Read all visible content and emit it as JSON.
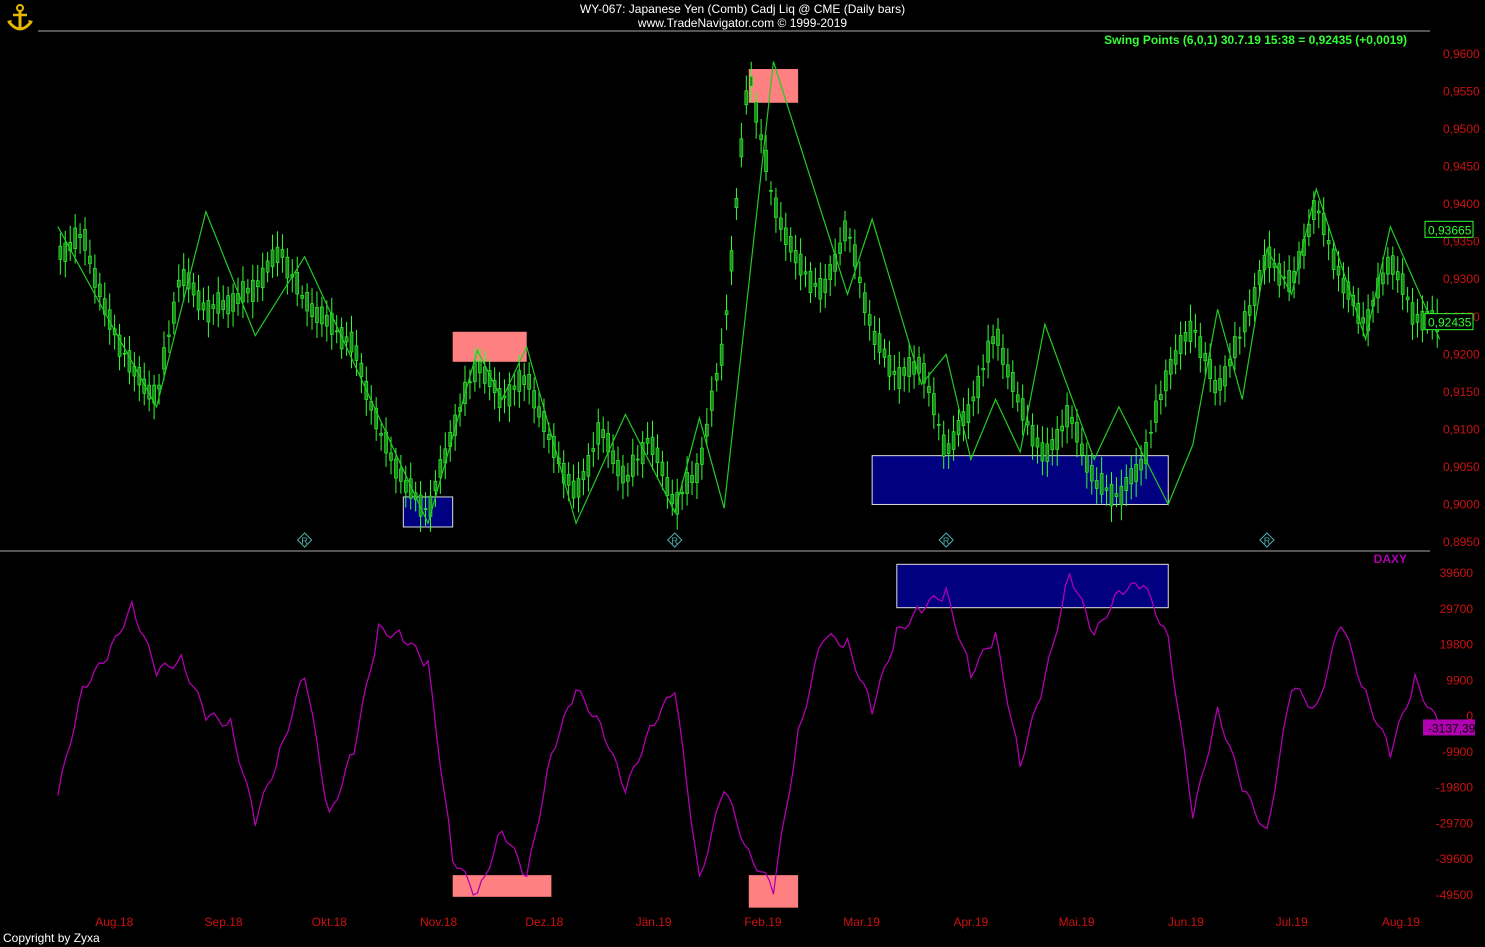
{
  "header": {
    "title": "WY-067:  Japanese Yen (Comb) Cadj Liq @ CME  (Daily bars)",
    "source": "www.TradeNavigator.com © 1999-2019"
  },
  "footer": {
    "copyright": "Copyright by Zyxa"
  },
  "colors": {
    "price": "#33ff33",
    "zigzag": "#22cc22",
    "axis_text": "#cc1111",
    "indicator": "#b000b0",
    "highlight_red": "#ff8080",
    "highlight_blue": "#000080",
    "separator": "#444444"
  },
  "chart_data": [
    {
      "type": "candlestick",
      "name": "Japanese Yen (Comb) Cadj Liq @ CME",
      "legend": "Swing Points (6,0,1)   30.7.19 15:38 = 0,92435 (+0,0019)",
      "ylim": [
        0.895,
        0.96
      ],
      "y_ticks": [
        "0,9600",
        "0,9550",
        "0,9500",
        "0,9450",
        "0,9400",
        "0,9350",
        "0,9300",
        "0,9250",
        "0,9200",
        "0,9150",
        "0,9100",
        "0,9050",
        "0,9000",
        "0,8950"
      ],
      "y_tick_values": [
        0.96,
        0.955,
        0.95,
        0.945,
        0.94,
        0.935,
        0.93,
        0.925,
        0.92,
        0.915,
        0.91,
        0.905,
        0.9,
        0.895
      ],
      "price_labels": [
        {
          "text": "0,93665",
          "value": 0.93665
        },
        {
          "text": "0,92435",
          "value": 0.92435
        }
      ],
      "close_series": [
        {
          "date": "2018-07-16",
          "value": 0.933
        },
        {
          "date": "2018-07-23",
          "value": 0.936
        },
        {
          "date": "2018-07-30",
          "value": 0.925
        },
        {
          "date": "2018-08-06",
          "value": 0.918
        },
        {
          "date": "2018-08-13",
          "value": 0.914
        },
        {
          "date": "2018-08-20",
          "value": 0.931
        },
        {
          "date": "2018-08-27",
          "value": 0.926
        },
        {
          "date": "2018-09-03",
          "value": 0.927
        },
        {
          "date": "2018-09-10",
          "value": 0.929
        },
        {
          "date": "2018-09-17",
          "value": 0.934
        },
        {
          "date": "2018-09-24",
          "value": 0.927
        },
        {
          "date": "2018-10-01",
          "value": 0.924
        },
        {
          "date": "2018-10-08",
          "value": 0.921
        },
        {
          "date": "2018-10-15",
          "value": 0.91
        },
        {
          "date": "2018-10-22",
          "value": 0.903
        },
        {
          "date": "2018-10-29",
          "value": 0.899
        },
        {
          "date": "2018-11-05",
          "value": 0.91
        },
        {
          "date": "2018-11-12",
          "value": 0.919
        },
        {
          "date": "2018-11-19",
          "value": 0.914
        },
        {
          "date": "2018-11-26",
          "value": 0.917
        },
        {
          "date": "2018-12-03",
          "value": 0.908
        },
        {
          "date": "2018-12-10",
          "value": 0.901
        },
        {
          "date": "2018-12-17",
          "value": 0.91
        },
        {
          "date": "2018-12-24",
          "value": 0.903
        },
        {
          "date": "2018-12-31",
          "value": 0.909
        },
        {
          "date": "2019-01-07",
          "value": 0.9
        },
        {
          "date": "2019-01-14",
          "value": 0.905
        },
        {
          "date": "2019-01-21",
          "value": 0.922
        },
        {
          "date": "2019-01-28",
          "value": 0.958
        },
        {
          "date": "2019-02-04",
          "value": 0.94
        },
        {
          "date": "2019-02-11",
          "value": 0.932
        },
        {
          "date": "2019-02-18",
          "value": 0.928
        },
        {
          "date": "2019-02-25",
          "value": 0.937
        },
        {
          "date": "2019-03-04",
          "value": 0.923
        },
        {
          "date": "2019-03-11",
          "value": 0.917
        },
        {
          "date": "2019-03-18",
          "value": 0.919
        },
        {
          "date": "2019-03-25",
          "value": 0.907
        },
        {
          "date": "2019-04-01",
          "value": 0.913
        },
        {
          "date": "2019-04-08",
          "value": 0.923
        },
        {
          "date": "2019-04-15",
          "value": 0.913
        },
        {
          "date": "2019-04-22",
          "value": 0.906
        },
        {
          "date": "2019-04-29",
          "value": 0.912
        },
        {
          "date": "2019-05-06",
          "value": 0.903
        },
        {
          "date": "2019-05-13",
          "value": 0.901
        },
        {
          "date": "2019-05-20",
          "value": 0.906
        },
        {
          "date": "2019-05-27",
          "value": 0.918
        },
        {
          "date": "2019-06-03",
          "value": 0.924
        },
        {
          "date": "2019-06-10",
          "value": 0.915
        },
        {
          "date": "2019-06-17",
          "value": 0.923
        },
        {
          "date": "2019-06-24",
          "value": 0.933
        },
        {
          "date": "2019-07-01",
          "value": 0.929
        },
        {
          "date": "2019-07-08",
          "value": 0.94
        },
        {
          "date": "2019-07-15",
          "value": 0.93
        },
        {
          "date": "2019-07-22",
          "value": 0.924
        },
        {
          "date": "2019-07-29",
          "value": 0.933
        },
        {
          "date": "2019-08-05",
          "value": 0.925
        },
        {
          "date": "2019-08-12",
          "value": 0.92435
        }
      ],
      "swing_points": [
        {
          "date": "2018-07-16",
          "value": 0.937
        },
        {
          "date": "2018-08-13",
          "value": 0.913
        },
        {
          "date": "2018-08-27",
          "value": 0.939
        },
        {
          "date": "2018-09-10",
          "value": 0.9225
        },
        {
          "date": "2018-09-24",
          "value": 0.933
        },
        {
          "date": "2018-10-29",
          "value": 0.8975
        },
        {
          "date": "2018-11-12",
          "value": 0.9205
        },
        {
          "date": "2018-11-19",
          "value": 0.914
        },
        {
          "date": "2018-11-26",
          "value": 0.921
        },
        {
          "date": "2018-12-10",
          "value": 0.8975
        },
        {
          "date": "2018-12-24",
          "value": 0.912
        },
        {
          "date": "2019-01-07",
          "value": 0.899
        },
        {
          "date": "2019-01-14",
          "value": 0.9115
        },
        {
          "date": "2019-01-21",
          "value": 0.8995
        },
        {
          "date": "2019-02-04",
          "value": 0.959
        },
        {
          "date": "2019-02-25",
          "value": 0.928
        },
        {
          "date": "2019-03-04",
          "value": 0.938
        },
        {
          "date": "2019-03-18",
          "value": 0.916
        },
        {
          "date": "2019-03-25",
          "value": 0.92
        },
        {
          "date": "2019-04-01",
          "value": 0.906
        },
        {
          "date": "2019-04-08",
          "value": 0.914
        },
        {
          "date": "2019-04-15",
          "value": 0.907
        },
        {
          "date": "2019-04-22",
          "value": 0.924
        },
        {
          "date": "2019-05-06",
          "value": 0.906
        },
        {
          "date": "2019-05-13",
          "value": 0.913
        },
        {
          "date": "2019-05-27",
          "value": 0.9
        },
        {
          "date": "2019-06-03",
          "value": 0.908
        },
        {
          "date": "2019-06-10",
          "value": 0.926
        },
        {
          "date": "2019-06-17",
          "value": 0.914
        },
        {
          "date": "2019-06-24",
          "value": 0.934
        },
        {
          "date": "2019-07-01",
          "value": 0.928
        },
        {
          "date": "2019-07-08",
          "value": 0.942
        },
        {
          "date": "2019-07-22",
          "value": 0.922
        },
        {
          "date": "2019-07-29",
          "value": 0.937
        },
        {
          "date": "2019-08-12",
          "value": 0.922
        }
      ],
      "highlight_zones": [
        {
          "color": "blue",
          "from": "2018-10-22",
          "to": "2018-11-05",
          "y": [
            0.897,
            0.901
          ]
        },
        {
          "color": "red",
          "from": "2018-11-05",
          "to": "2018-11-26",
          "y": [
            0.919,
            0.923
          ]
        },
        {
          "color": "red",
          "from": "2019-01-28",
          "to": "2019-02-11",
          "y": [
            0.9535,
            0.958
          ]
        },
        {
          "color": "blue",
          "from": "2019-03-04",
          "to": "2019-05-27",
          "y": [
            0.9,
            0.9065
          ]
        }
      ],
      "markers": [
        {
          "date": "2018-09-24",
          "label": "R"
        },
        {
          "date": "2019-01-07",
          "label": "R"
        },
        {
          "date": "2019-03-25",
          "label": "R"
        },
        {
          "date": "2019-06-24",
          "label": "R"
        }
      ]
    },
    {
      "type": "line",
      "series_name": "DAXY",
      "ylim": [
        -55000,
        44000
      ],
      "y_ticks": [
        "39600",
        "29700",
        "19800",
        "9900",
        "0",
        "-9900",
        "-19800",
        "-29700",
        "-39600",
        "-49500"
      ],
      "y_tick_values": [
        39600,
        29700,
        19800,
        9900,
        0,
        -9900,
        -19800,
        -29700,
        -39600,
        -49500
      ],
      "current_label": "-3137,39",
      "current_value": -3137.39,
      "values": [
        {
          "date": "2018-07-16",
          "value": -22000
        },
        {
          "date": "2018-07-23",
          "value": 8000
        },
        {
          "date": "2018-07-30",
          "value": 16000
        },
        {
          "date": "2018-08-06",
          "value": 31000
        },
        {
          "date": "2018-08-13",
          "value": 12000
        },
        {
          "date": "2018-08-20",
          "value": 16000
        },
        {
          "date": "2018-08-27",
          "value": 0
        },
        {
          "date": "2018-09-03",
          "value": -2000
        },
        {
          "date": "2018-09-10",
          "value": -29000
        },
        {
          "date": "2018-09-17",
          "value": -10000
        },
        {
          "date": "2018-09-24",
          "value": 12000
        },
        {
          "date": "2018-10-01",
          "value": -28000
        },
        {
          "date": "2018-10-08",
          "value": -9000
        },
        {
          "date": "2018-10-15",
          "value": 24000
        },
        {
          "date": "2018-10-22",
          "value": 22000
        },
        {
          "date": "2018-10-29",
          "value": 14000
        },
        {
          "date": "2018-11-05",
          "value": -39000
        },
        {
          "date": "2018-11-12",
          "value": -50000
        },
        {
          "date": "2018-11-19",
          "value": -31000
        },
        {
          "date": "2018-11-26",
          "value": -45000
        },
        {
          "date": "2018-12-03",
          "value": -10000
        },
        {
          "date": "2018-12-10",
          "value": 7000
        },
        {
          "date": "2018-12-17",
          "value": -2000
        },
        {
          "date": "2018-12-24",
          "value": -21000
        },
        {
          "date": "2018-12-31",
          "value": -3000
        },
        {
          "date": "2019-01-07",
          "value": 7000
        },
        {
          "date": "2019-01-14",
          "value": -45000
        },
        {
          "date": "2019-01-21",
          "value": -20000
        },
        {
          "date": "2019-01-28",
          "value": -38000
        },
        {
          "date": "2019-02-04",
          "value": -48000
        },
        {
          "date": "2019-02-11",
          "value": -5000
        },
        {
          "date": "2019-02-18",
          "value": 22000
        },
        {
          "date": "2019-02-25",
          "value": 20000
        },
        {
          "date": "2019-03-04",
          "value": 2000
        },
        {
          "date": "2019-03-11",
          "value": 23000
        },
        {
          "date": "2019-03-18",
          "value": 30000
        },
        {
          "date": "2019-03-25",
          "value": 34000
        },
        {
          "date": "2019-04-01",
          "value": 12000
        },
        {
          "date": "2019-04-08",
          "value": 22000
        },
        {
          "date": "2019-04-15",
          "value": -13000
        },
        {
          "date": "2019-04-22",
          "value": 10000
        },
        {
          "date": "2019-04-29",
          "value": 40000
        },
        {
          "date": "2019-05-06",
          "value": 22000
        },
        {
          "date": "2019-05-13",
          "value": 35000
        },
        {
          "date": "2019-05-20",
          "value": 36000
        },
        {
          "date": "2019-05-27",
          "value": 22000
        },
        {
          "date": "2019-06-03",
          "value": -28000
        },
        {
          "date": "2019-06-10",
          "value": 2000
        },
        {
          "date": "2019-06-17",
          "value": -20000
        },
        {
          "date": "2019-06-24",
          "value": -32000
        },
        {
          "date": "2019-07-01",
          "value": 8000
        },
        {
          "date": "2019-07-08",
          "value": 2000
        },
        {
          "date": "2019-07-15",
          "value": 26000
        },
        {
          "date": "2019-07-22",
          "value": 6000
        },
        {
          "date": "2019-07-29",
          "value": -10000
        },
        {
          "date": "2019-08-05",
          "value": 10000
        },
        {
          "date": "2019-08-12",
          "value": -3137
        }
      ],
      "highlight_zones": [
        {
          "color": "blue",
          "from": "2019-03-11",
          "to": "2019-05-27",
          "y": [
            30000,
            42000
          ]
        },
        {
          "color": "red",
          "from": "2018-11-05",
          "to": "2018-12-03",
          "y": [
            -50000,
            -44000
          ]
        },
        {
          "color": "red",
          "from": "2019-01-28",
          "to": "2019-02-11",
          "y": [
            -53000,
            -44000
          ]
        }
      ]
    }
  ],
  "x_axis": {
    "labels": [
      "Aug.18",
      "Sep.18",
      "Okt.18",
      "Nov.18",
      "Dez.18",
      "Jän.19",
      "Feb.19",
      "Mar.19",
      "Apr.19",
      "Mai.19",
      "Jun.19",
      "Jul.19",
      "Aug.19"
    ],
    "dates": [
      "2018-08-01",
      "2018-09-01",
      "2018-10-01",
      "2018-11-01",
      "2018-12-01",
      "2019-01-01",
      "2019-02-01",
      "2019-03-01",
      "2019-04-01",
      "2019-05-01",
      "2019-06-01",
      "2019-07-01",
      "2019-08-01"
    ],
    "start": "2018-07-01",
    "end": "2019-08-05"
  }
}
